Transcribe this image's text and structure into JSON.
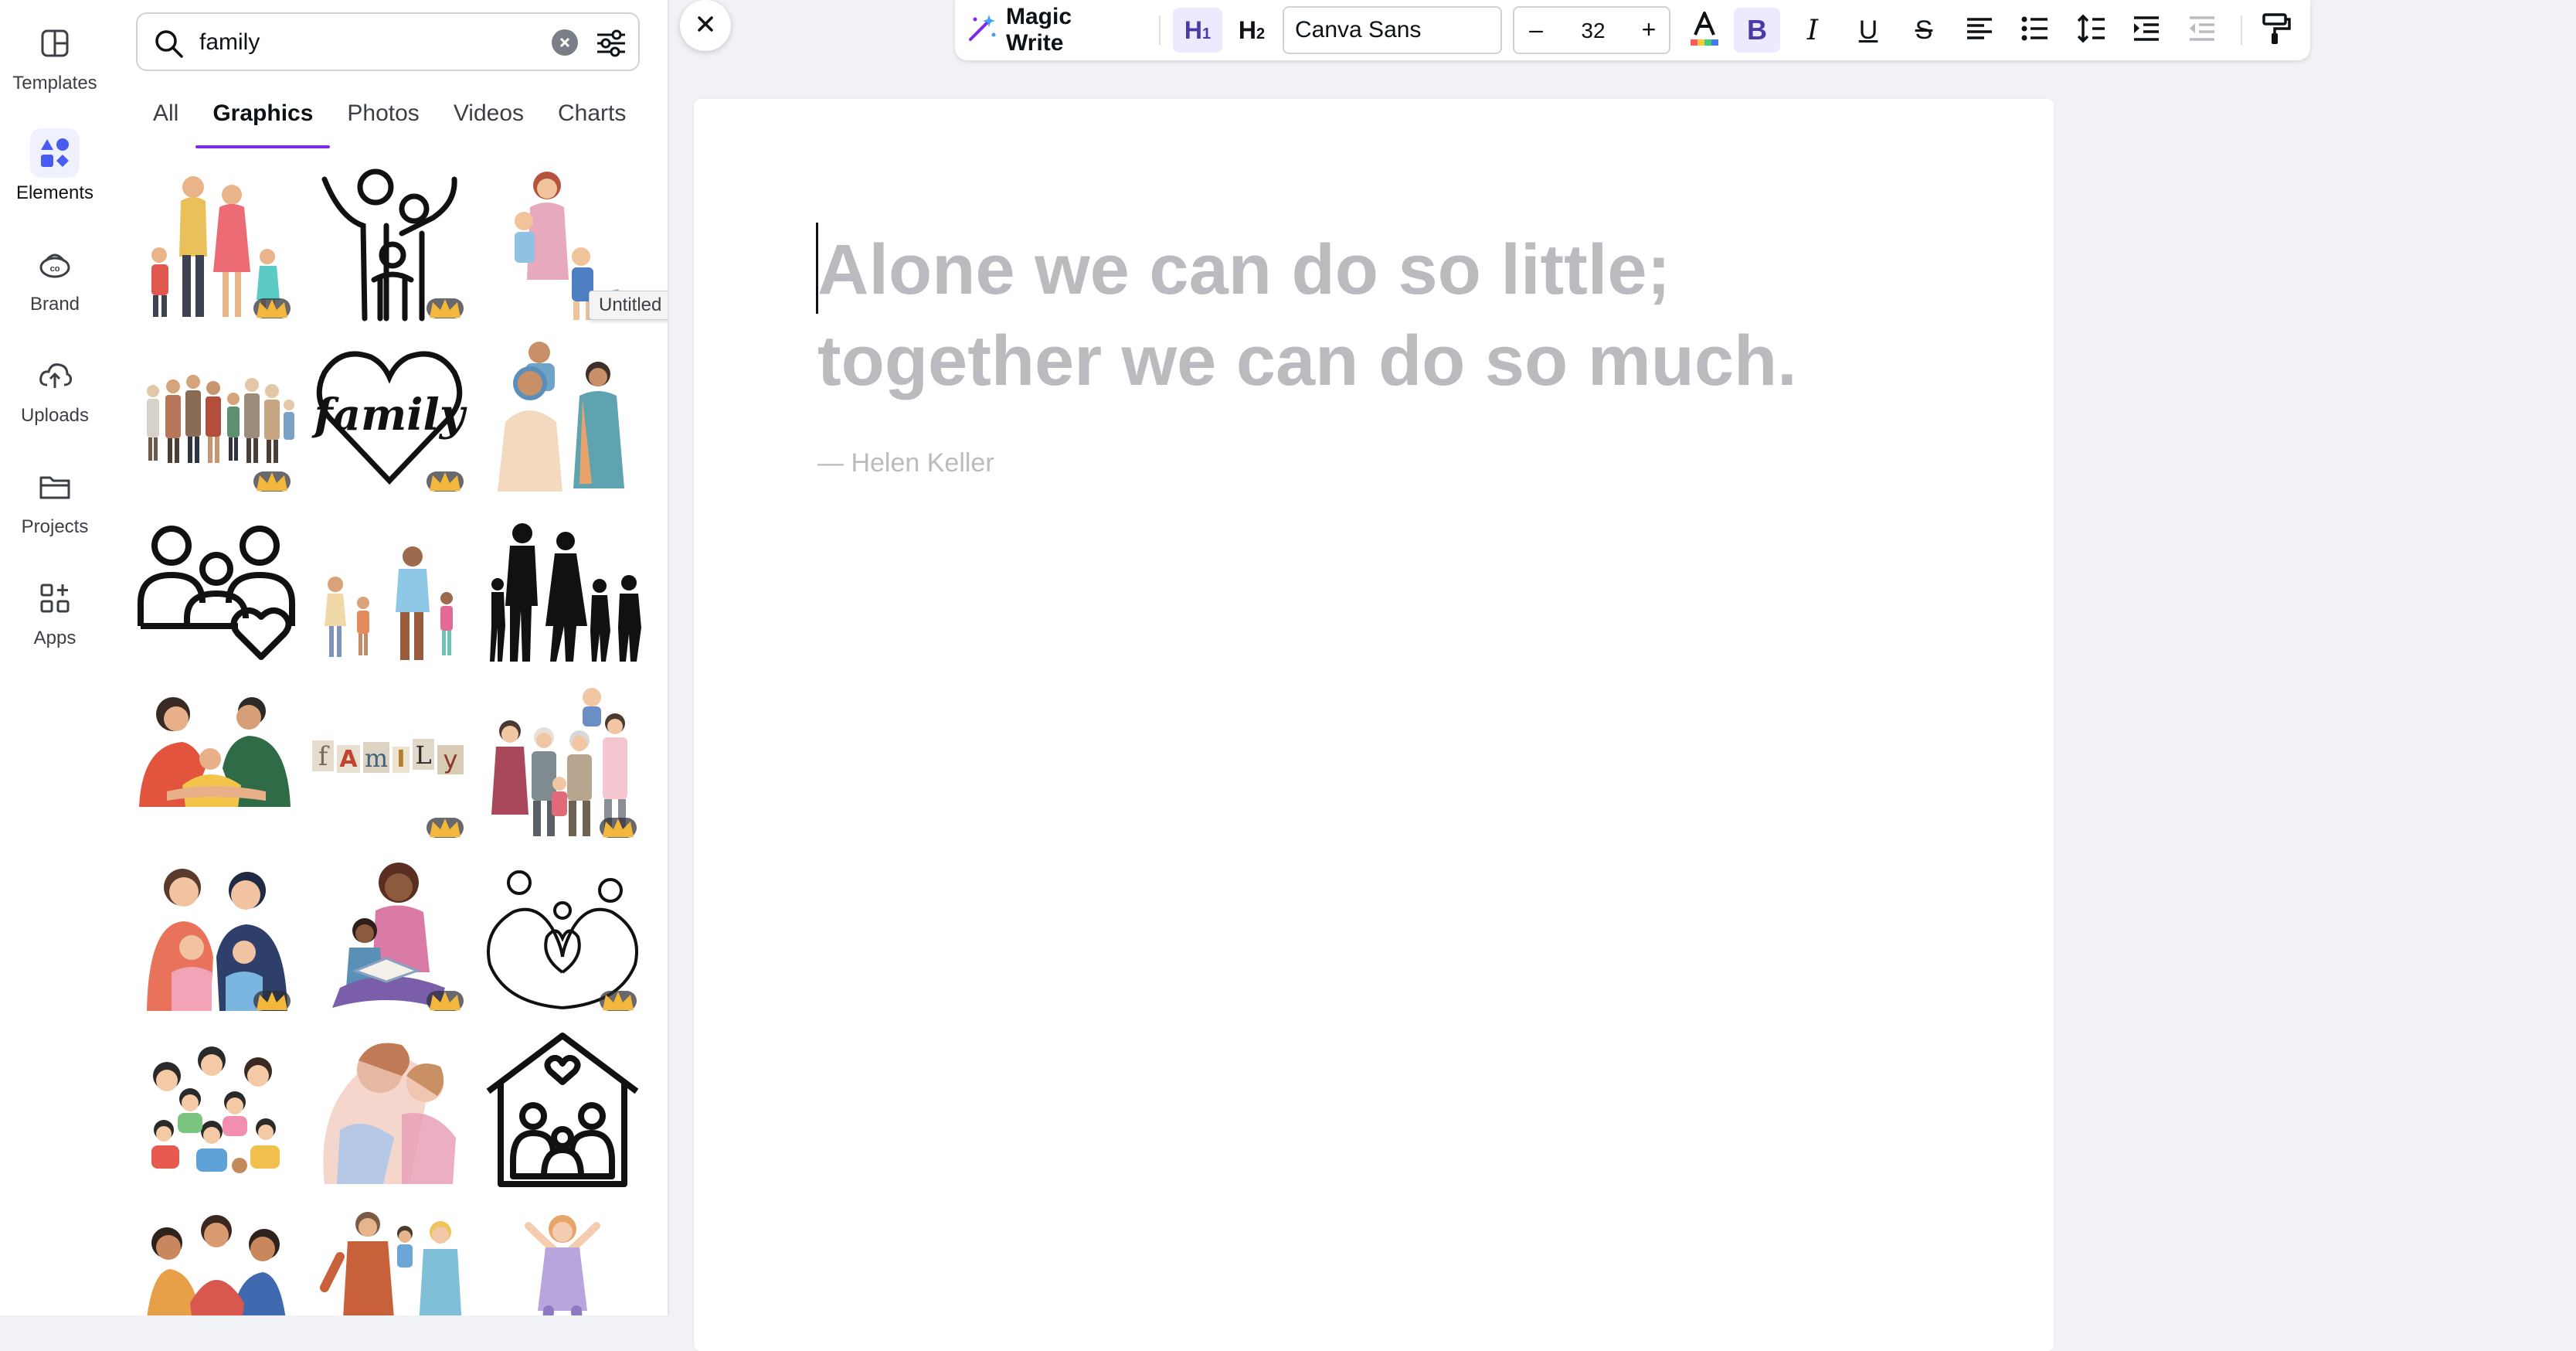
{
  "rail": {
    "items": [
      {
        "label": "Templates",
        "icon": "templates-icon"
      },
      {
        "label": "Elements",
        "icon": "elements-icon"
      },
      {
        "label": "Brand",
        "icon": "brand-icon"
      },
      {
        "label": "Uploads",
        "icon": "uploads-icon"
      },
      {
        "label": "Projects",
        "icon": "projects-icon"
      },
      {
        "label": "Apps",
        "icon": "apps-icon"
      }
    ],
    "active": "Elements"
  },
  "search": {
    "value": "family"
  },
  "tabs": [
    "All",
    "Graphics",
    "Photos",
    "Videos",
    "Charts"
  ],
  "active_tab": "Graphics",
  "tooltip": "Untitled design - Doc",
  "grid": {
    "items": [
      {
        "desc": "family-illustration",
        "premium": true
      },
      {
        "desc": "family-line-art",
        "premium": true
      },
      {
        "desc": "mother-children-illustration",
        "premium": true
      },
      {
        "desc": "extended-family-illustration",
        "premium": true
      },
      {
        "desc": "family-heart-lettering",
        "premium": true
      },
      {
        "desc": "father-child-illustration",
        "premium": false
      },
      {
        "desc": "family-heart-outline-icon",
        "premium": false
      },
      {
        "desc": "family-walking-illustration",
        "premium": false
      },
      {
        "desc": "family-silhouette",
        "premium": false
      },
      {
        "desc": "parents-hugging-child-illustration",
        "premium": false
      },
      {
        "desc": "family-letters-cutout",
        "premium": true
      },
      {
        "desc": "grandparents-family-illustration",
        "premium": true
      },
      {
        "desc": "family-portrait-illustration",
        "premium": true
      },
      {
        "desc": "mother-reading-illustration",
        "premium": true
      },
      {
        "desc": "family-heart-line-art",
        "premium": true
      },
      {
        "desc": "group-family-illustration",
        "premium": false
      },
      {
        "desc": "watercolor-family-illustration",
        "premium": false
      },
      {
        "desc": "family-house-icon",
        "premium": false
      },
      {
        "desc": "family-hug-illustration",
        "premium": false
      },
      {
        "desc": "father-kids-illustration",
        "premium": false
      },
      {
        "desc": "child-jumping-illustration",
        "premium": false
      }
    ]
  },
  "toolbar": {
    "magic_write": "Magic Write",
    "h1": "H1",
    "h2": "H2",
    "font": "Canva Sans",
    "size": "32",
    "minus": "–",
    "plus": "+",
    "colors": {
      "accent": "#7d2ae8",
      "bold_bg": "#eceaff"
    }
  },
  "doc": {
    "quote": "Alone we can do so little; together we can do so much.",
    "attribution": "— Helen Keller"
  }
}
